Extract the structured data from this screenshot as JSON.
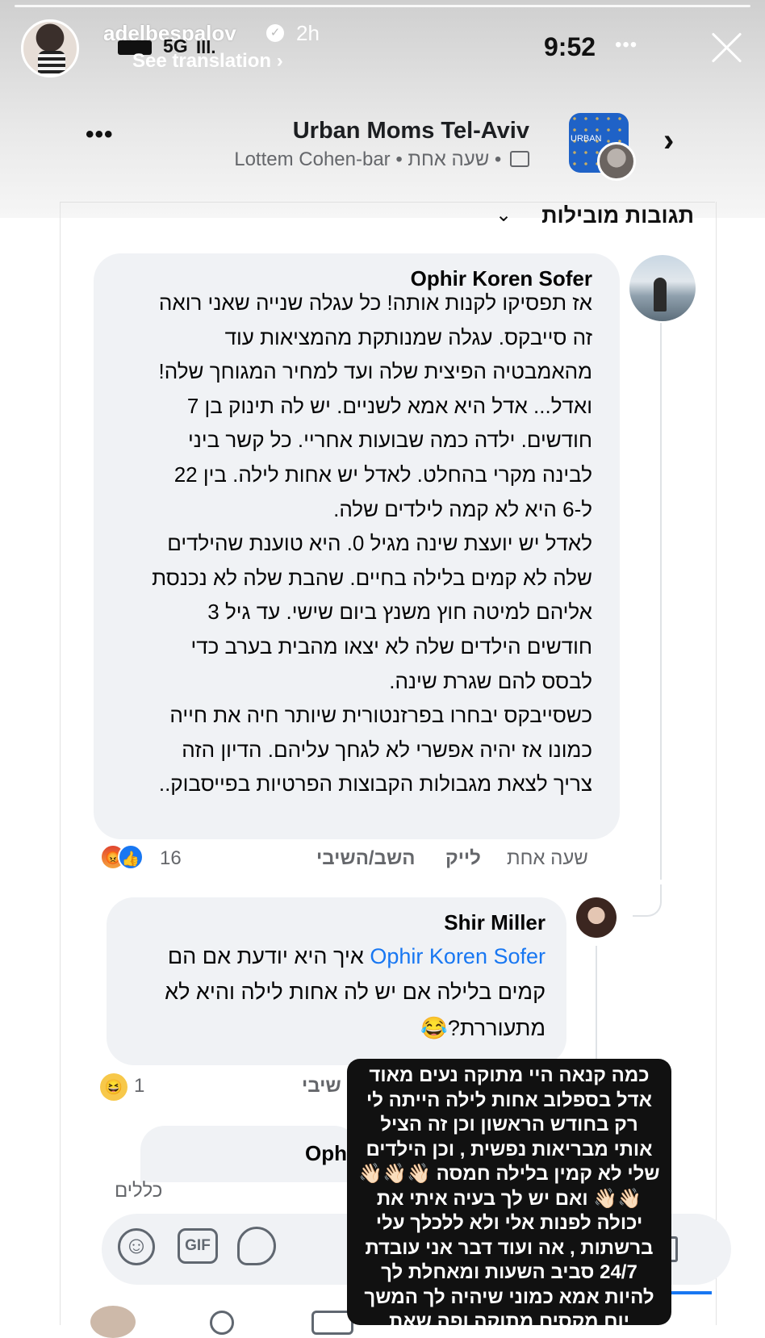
{
  "story": {
    "username": "adelbespalov",
    "time_ago": "2h",
    "see_translation": "See translation",
    "status_time": "9:52",
    "network": "5G",
    "signal": "Ill.",
    "more": "•••"
  },
  "post": {
    "group_name": "Urban Moms Tel-Aviv",
    "meta": "Lottem Cohen-bar • שעה אחת •",
    "group_thumb_label": "URBAN",
    "more": "•••"
  },
  "top_comments": "תגובות מובילות",
  "comments": [
    {
      "author": "Ophir Koren Sofer",
      "lines": [
        "אז תפסיקו לקנות אותה! כל עגלה שנייה שאני רואה",
        "זה סייבקס. עגלה שמנותקת מהמציאות עוד",
        "מהאמבטיה הפיצית שלה ועד למחיר המגוחך שלה!",
        "ואדל... אדל היא אמא לשניים. יש לה תינוק בן 7",
        "חודשים. ילדה כמה שבועות אחריי. כל קשר ביני",
        "לבינה מקרי בהחלט. לאדל יש אחות לילה. בין 22",
        "ל-6 היא לא קמה לילדים שלה.",
        "לאדל יש יועצת שינה מגיל 0. היא טוענת שהילדים",
        "שלה לא קמים בלילה בחיים. שהבת שלה לא נכנסת",
        "אליהם למיטה חוץ משנץ ביום שישי. עד גיל 3",
        "חודשים הילדים שלה לא יצאו מהבית בערב כדי",
        "לבסס להם שגרת שינה.",
        "כשסייבקס יבחרו בפרזנטורית שיותר חיה את חייה",
        "כמונו אז יהיה אפשרי לא לגחך עליהם. הדיון הזה",
        "צריך לצאת מגבולות הקבוצות הפרטיות בפייסבוק.."
      ],
      "time": "שעה אחת",
      "like": "לייק",
      "reply": "השב/השיבי",
      "reactions_count": "16"
    },
    {
      "author": "Shir Miller",
      "mention": "Ophir Koren Sofer",
      "line1_rest": "איך היא יודעת אם הם",
      "line2": "קמים בלילה אם יש לה אחות לילה והיא לא",
      "line3": "מתעוררת?😂",
      "reply_partial": "שיבי",
      "reactions_count": "1"
    },
    {
      "author_partial": "Oph"
    }
  ],
  "overlay_lines": [
    "כמה קנאה היי מתוקה נעים מאוד",
    "אדל בספלוב אחות לילה הייתה לי",
    "רק בחודש הראשון וכן זה הציל",
    "אותי מבריאות נפשית , וכן הילדים",
    "שלי לא קמין בלילה חמסה 👋🏻👋🏻👋🏻",
    "👋🏻👋🏻 ואם יש לך בעיה איתי את",
    "יכולה לפנות אלי ולא ללכלך עלי",
    "ברשתות , אה ועוד דבר אני עובדת",
    "24/7 סביב השעות ומאחלת לך",
    "להיות אמא כמוני שיהיה לך המשך",
    "יום מקסים מתוקה ופה שאת"
  ],
  "filter_label": "כללים",
  "composer": {
    "gif_label": "GIF",
    "emoji_icon": "☺"
  },
  "colors": {
    "link_blue": "#1877f2",
    "bubble_gray": "#f0f2f5",
    "meta_gray": "#65676b",
    "overlay_black": "#111111"
  }
}
